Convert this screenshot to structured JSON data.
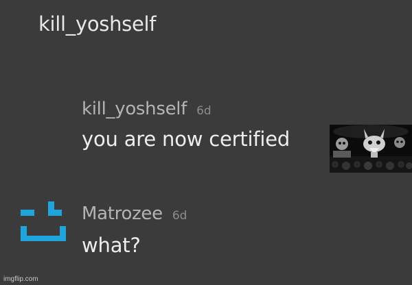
{
  "thread": {
    "parent_username": "kill_yoshself"
  },
  "replies": [
    {
      "username": "kill_yoshself",
      "time": "6d",
      "text": "you are now certified",
      "attachment": "meme-image-thumbnail"
    },
    {
      "username": "Matrozee",
      "time": "6d",
      "text": "what?",
      "avatar": "pixel-smiley-avatar-icon",
      "avatar_color": "#1ea6dc"
    }
  ],
  "watermark": "imgflip.com",
  "colors": {
    "background": "#3b3b3c",
    "username": "#b4b4b4",
    "text": "#eeeeee",
    "timestamp": "#8c8c8c"
  }
}
